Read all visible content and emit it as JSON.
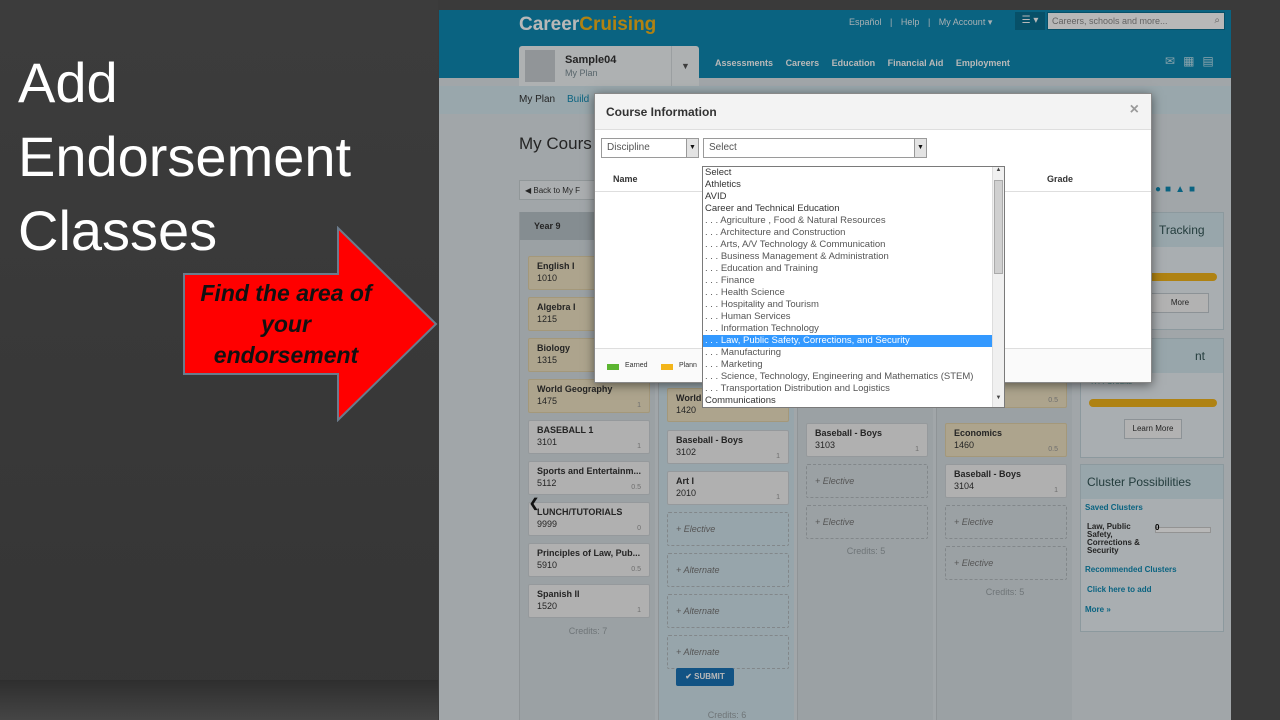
{
  "slide": {
    "title_lines": [
      "Add",
      "Endorsement",
      "Classes"
    ],
    "callout": "Find the area of your endorsement"
  },
  "colors": {
    "brand": "#0f8ab3",
    "callout": "#ff0000",
    "highlight": "#3399ff",
    "planned": "#f0e4c4"
  },
  "app": {
    "logo_a": "Career",
    "logo_b": "Cruising",
    "top_links": [
      "Español",
      "|",
      "Help",
      "|",
      "My Account ▾"
    ],
    "search_placeholder": "Careers, schools and more...",
    "profile": {
      "name": "Sample04",
      "subtitle": "My Plan"
    },
    "nav": [
      "Assessments",
      "Careers",
      "Education",
      "Financial Aid",
      "Employment"
    ],
    "subnav": {
      "my_plan": "My Plan",
      "build": "Build"
    },
    "page_title": "My Cours",
    "back_button": "Back to My F",
    "year_label": "Year 9",
    "col1": [
      {
        "title": "English I",
        "code": "1010",
        "credit": "",
        "plan": true
      },
      {
        "title": "Algebra I",
        "code": "1215",
        "credit": "",
        "plan": true
      },
      {
        "title": "Biology",
        "code": "1315",
        "credit": "",
        "plan": true
      },
      {
        "title": "World Geography",
        "code": "1475",
        "credit": "1",
        "plan": true
      },
      {
        "title": "BASEBALL 1",
        "code": "3101",
        "credit": "1",
        "plan": false
      },
      {
        "title": "Sports and Entertainm...",
        "code": "5112",
        "credit": "0.5",
        "plan": false
      },
      {
        "title": "LUNCH/TUTORIALS",
        "code": "9999",
        "credit": "0",
        "plan": false
      },
      {
        "title": "Principles of Law, Pub...",
        "code": "5910",
        "credit": "0.5",
        "plan": false
      },
      {
        "title": "Spanish II",
        "code": "1520",
        "credit": "1",
        "plan": false
      }
    ],
    "col1_credits": "Credits: 7",
    "col2": [
      {
        "title": "World",
        "code": "1420",
        "credit": "",
        "plan": true
      },
      {
        "title": "Baseball - Boys",
        "code": "3102",
        "credit": "1",
        "plan": false
      },
      {
        "title": "Art I",
        "code": "2010",
        "credit": "1",
        "plan": false
      }
    ],
    "col2_slots": [
      "Elective",
      "Alternate",
      "Alternate",
      "Alternate"
    ],
    "submit": "SUBMIT",
    "col2_credits": "Credits: 6",
    "col3": [
      {
        "title": "Baseball - Boys",
        "code": "3103",
        "credit": "1",
        "plan": false
      }
    ],
    "col3_slots": [
      "Elective",
      "Elective"
    ],
    "col3_credits": "Credits: 5",
    "col4": [
      {
        "title": "Economics",
        "code": "1460",
        "credit": "0.5",
        "plan": true
      },
      {
        "title": "Baseball - Boys",
        "code": "3104",
        "credit": "1",
        "plan": false
      }
    ],
    "col4_top_credit": "0.5",
    "col4_slots": [
      "Elective",
      "Elective"
    ],
    "col4_credits": "Credits: 5",
    "right": {
      "tracking": "Tracking",
      "more_btn": "More",
      "second_head": "nt",
      "credits_text": "47.4 Credits",
      "learn_more": "Learn More",
      "cluster_head": "Cluster Possibilities",
      "saved_clusters": "Saved Clusters",
      "saved_item": "Law, Public Safety, Corrections & Security",
      "saved_count": "0",
      "recommended": "Recommended Clusters",
      "click_add": "Click here to add",
      "more": "More »"
    }
  },
  "modal": {
    "title": "Course Information",
    "close": "×",
    "discipline_value": "Discipline",
    "select_value": "Select",
    "col_name": "Name",
    "col_grade": "Grade",
    "legend_earned": "Earned",
    "legend_planned": "Plann",
    "options": [
      {
        "label": "Select",
        "sub": false,
        "hl": false
      },
      {
        "label": "Athletics",
        "sub": false,
        "hl": false
      },
      {
        "label": "AVID",
        "sub": false,
        "hl": false
      },
      {
        "label": "Career and Technical Education",
        "sub": false,
        "hl": false
      },
      {
        "label": ". . . Agriculture , Food & Natural Resources",
        "sub": true,
        "hl": false
      },
      {
        "label": ". . . Architecture and Construction",
        "sub": true,
        "hl": false
      },
      {
        "label": ". . . Arts, A/V Technology & Communication",
        "sub": true,
        "hl": false
      },
      {
        "label": ". . . Business Management & Administration",
        "sub": true,
        "hl": false
      },
      {
        "label": ". . . Education and Training",
        "sub": true,
        "hl": false
      },
      {
        "label": ". . . Finance",
        "sub": true,
        "hl": false
      },
      {
        "label": ". . . Health Science",
        "sub": true,
        "hl": false
      },
      {
        "label": ". . . Hospitality and Tourism",
        "sub": true,
        "hl": false
      },
      {
        "label": ". . . Human Services",
        "sub": true,
        "hl": false
      },
      {
        "label": ". . . Information Technology",
        "sub": true,
        "hl": false
      },
      {
        "label": ". . . Law, Public Safety, Corrections, and Security",
        "sub": true,
        "hl": true
      },
      {
        "label": ". . . Manufacturing",
        "sub": true,
        "hl": false
      },
      {
        "label": ". . . Marketing",
        "sub": true,
        "hl": false
      },
      {
        "label": ". . . Science, Technology, Engineering and Mathematics (STEM)",
        "sub": true,
        "hl": false
      },
      {
        "label": ". . . Transportation Distribution and Logistics",
        "sub": true,
        "hl": false
      },
      {
        "label": "Communications",
        "sub": false,
        "hl": false
      }
    ]
  }
}
